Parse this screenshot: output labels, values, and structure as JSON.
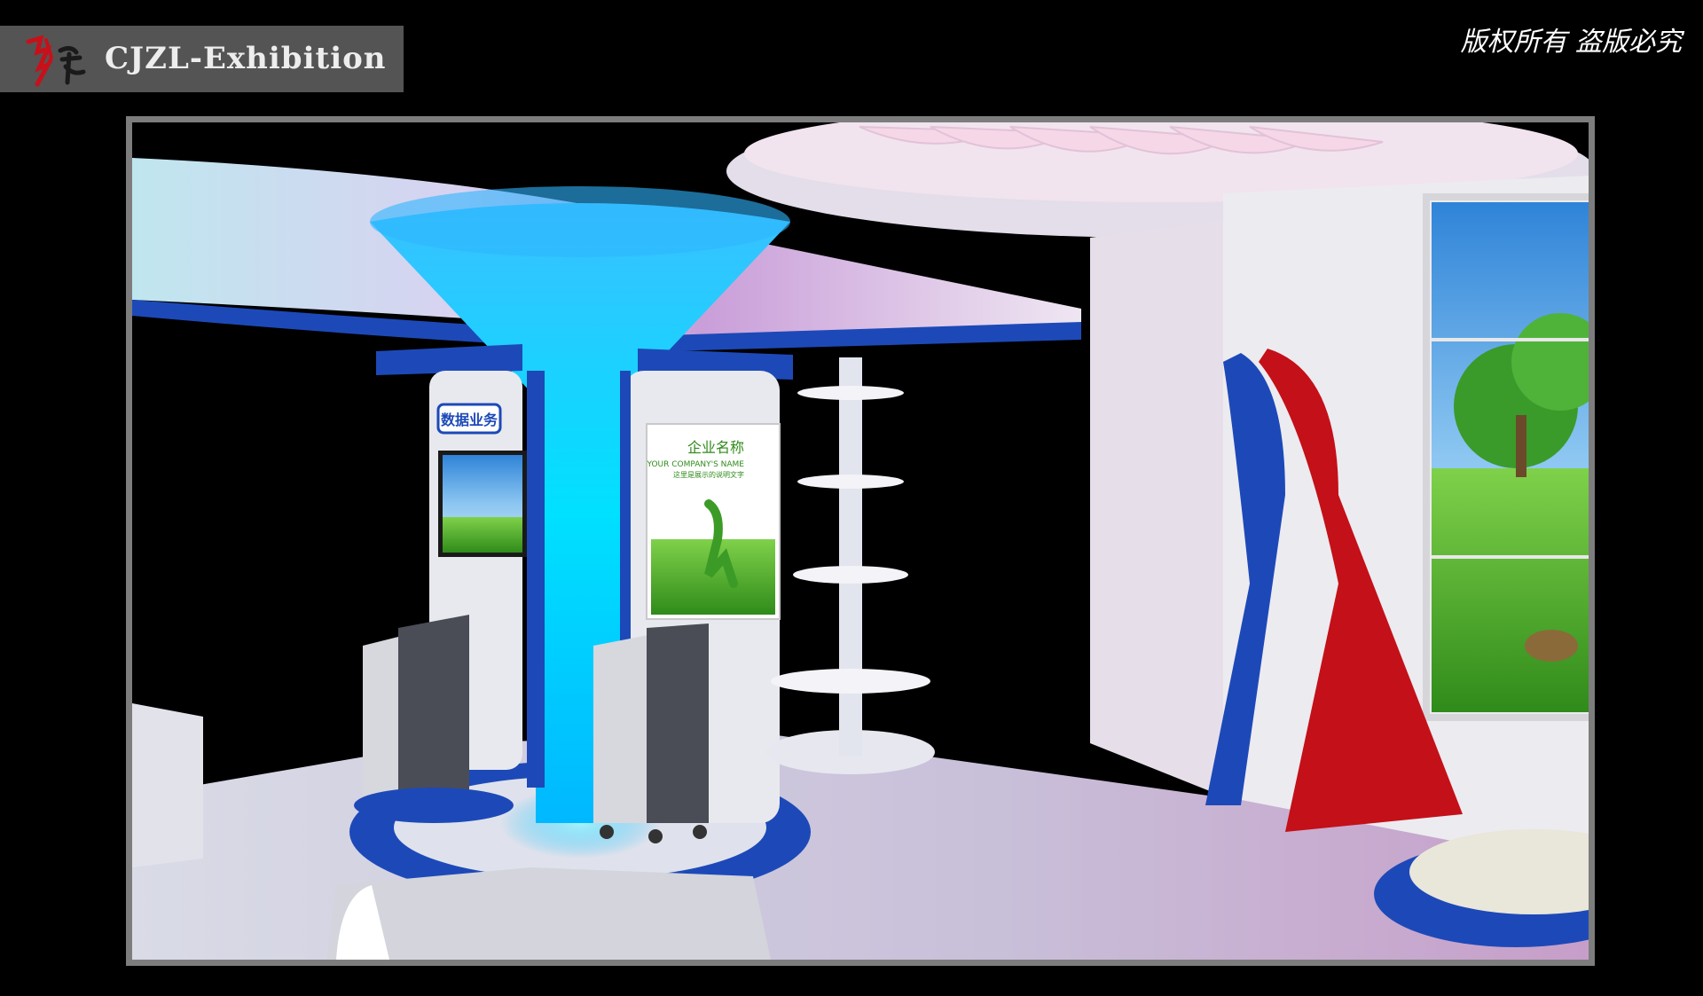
{
  "logo": {
    "calligraphy": "创绿",
    "text": "CJZL-Exhibition"
  },
  "copyright": {
    "text": "版权所有  盗版必究"
  },
  "scene": {
    "description_label": "",
    "sign_text": "数据业务",
    "poster_title": "企业名称",
    "poster_subtitle": "YOUR COMPANY'S NAME",
    "poster_caption": "这里是展示的说明文字"
  },
  "colors": {
    "background": "#000000",
    "logo_bar": "#545454",
    "frame_border": "#7d7d7d",
    "accent_blue": "#1d49b8",
    "accent_cyan": "#00d8ff",
    "accent_red": "#c41018",
    "wall_white": "#e9e9ef"
  }
}
